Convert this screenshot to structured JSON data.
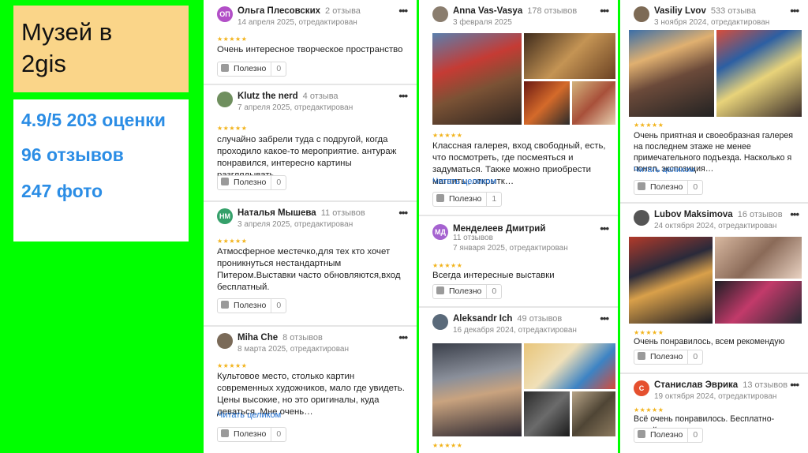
{
  "title": {
    "line1": "Музей в",
    "line2": "2gis"
  },
  "stats": {
    "rating": "4.9/5 203 оценки",
    "reviews": "96 отзывов",
    "photos": "247 фото"
  },
  "common": {
    "useful": "Полезно",
    "read_more": "Читать целиком",
    "menu": "•••",
    "stars": "★★★★★"
  },
  "col1": [
    {
      "name": "Ольга Плесовских",
      "count": "2 отзыва",
      "date": "14 апреля 2025, отредактирован",
      "initials": "ОП",
      "color": "#b24fc7",
      "text": "Очень интересное творческое пространство",
      "likes": "0"
    },
    {
      "name": "Klutz the nerd",
      "count": "4 отзыва",
      "date": "7 апреля 2025, отредактирован",
      "initials": "",
      "color": "#6f8f5e",
      "text": "случайно забрели туда с подругой, когда проходило какое-то мероприятие. антураж понравился, интересно картины разглядывать",
      "likes": "0"
    },
    {
      "name": "Наталья Мышева",
      "count": "11 отзывов",
      "date": "3 апреля 2025, отредактирован",
      "initials": "НМ",
      "color": "#35a06a",
      "text": "Атмосферное местечко,для тех кто хочет проникнуться нестандартным Питером.Выставки часто обновляются,вход бесплатный.",
      "likes": "0"
    },
    {
      "name": "Miha Che",
      "count": "8 отзывов",
      "date": "8 марта 2025, отредактирован",
      "initials": "",
      "color": "#7a6a58",
      "text": "Культовое место, столько картин современных художников, мало где увидеть. Цены высокие, но это оригиналы, куда деваться. Мне очень…",
      "likes": "0"
    }
  ],
  "col2": [
    {
      "name": "Anna Vas-Vasya",
      "count": "178 отзывов",
      "date": "3 февраля 2025",
      "initials": "",
      "color": "#8a7d6e",
      "text": "Классная галерея, вход свободный, есть, что посмотреть, где посмеяться и задуматься. Также можно приобрести магниты, открытк…",
      "likes": "1"
    },
    {
      "name": "Менделеев Дмитрий",
      "count": "11 отзывов",
      "date": "7 января 2025, отредактирован",
      "initials": "МД",
      "color": "#a562d0",
      "text": "Всегда интересные выставки",
      "likes": "0"
    },
    {
      "name": "Aleksandr Ich",
      "count": "49 отзывов",
      "date": "16 декабря 2024, отредактирован",
      "initials": "",
      "color": "#5a6a7a",
      "text": "",
      "likes": ""
    }
  ],
  "col3": [
    {
      "name": "Vasiliy Lvov",
      "count": "533 отзыва",
      "date": "3 ноября 2024, отредактирован",
      "initials": "",
      "color": "#7d6a55",
      "text": "Очень приятная и своеобразная галерея на последнем этаже не менее примечательного подъезда. Насколько я понял, экспозиция…",
      "likes": "0"
    },
    {
      "name": "Lubov Maksimova",
      "count": "16 отзывов",
      "date": "24 октября 2024, отредактирован",
      "initials": "",
      "color": "#555",
      "text": "Очень понравилось, всем рекомендую",
      "likes": "0"
    },
    {
      "name": "Станислав Эврика",
      "count": "13 отзывов",
      "date": "19 октября 2024, отредактирован",
      "initials": "С",
      "color": "#e5502f",
      "text": "Всё очень понравилось. Бесплатно- донейшен",
      "likes": "0"
    }
  ]
}
